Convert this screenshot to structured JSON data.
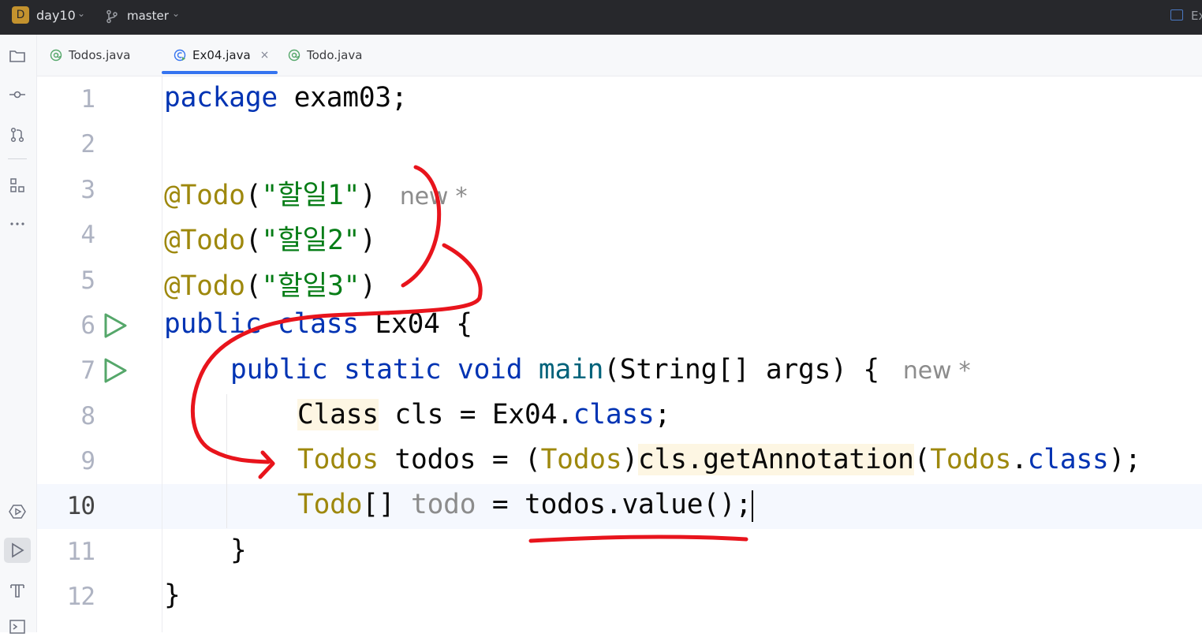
{
  "titlebar": {
    "project_badge": "D",
    "project_name": "day10",
    "branch_name": "master",
    "right_text": "Ex"
  },
  "tabs": [
    {
      "label": "Todos.java",
      "icon": "annotation-icon",
      "active": false
    },
    {
      "label": "Ex04.java",
      "icon": "class-run-icon",
      "active": true,
      "close": "×"
    },
    {
      "label": "Todo.java",
      "icon": "annotation-icon",
      "active": false
    }
  ],
  "editor": {
    "line_numbers": [
      "1",
      "2",
      "3",
      "4",
      "5",
      "6",
      "7",
      "8",
      "9",
      "10",
      "11",
      "12"
    ],
    "current_line": "10",
    "hints": {
      "line3": "new *",
      "line7": "new *"
    },
    "code": {
      "l1_kw": "package",
      "l1_rest": " exam03;",
      "l3_ann": "@Todo",
      "l3_open": "(",
      "l3_str": "\"할일1\"",
      "l3_close": ")",
      "l4_ann": "@Todo",
      "l4_open": "(",
      "l4_str": "\"할일2\"",
      "l4_close": ")",
      "l5_ann": "@Todo",
      "l5_open": "(",
      "l5_str": "\"할일3\"",
      "l5_close": ")",
      "l6_kw1": "public",
      "l6_kw2": "class",
      "l6_rest": " Ex04 {",
      "l7_kw1": "public",
      "l7_kw2": "static",
      "l7_kw3": "void",
      "l7_mtd": "main",
      "l7_rest": "(String[] args) {",
      "l8_type": "Class",
      "l8_rest": " cls = Ex04.",
      "l8_kw": "class",
      "l8_end": ";",
      "l9_type": "Todos",
      "l9_mid": " todos = (",
      "l9_type2": "Todos",
      "l9_paren": ")",
      "l9_call": "cls.getAnnotation",
      "l9_open": "(",
      "l9_type3": "Todos",
      "l9_dot": ".",
      "l9_kw": "class",
      "l9_end": ");",
      "l10_type": "Todo",
      "l10_br": "[] ",
      "l10_var": "todo",
      "l10_rest": " = todos.value();",
      "l11": "}",
      "l12": "}"
    }
  },
  "colors": {
    "keyword": "#0033b3",
    "annotation": "#9e880d",
    "string": "#067d17",
    "method": "#00627a",
    "pen": "#e8141c",
    "accent": "#3574f0"
  }
}
